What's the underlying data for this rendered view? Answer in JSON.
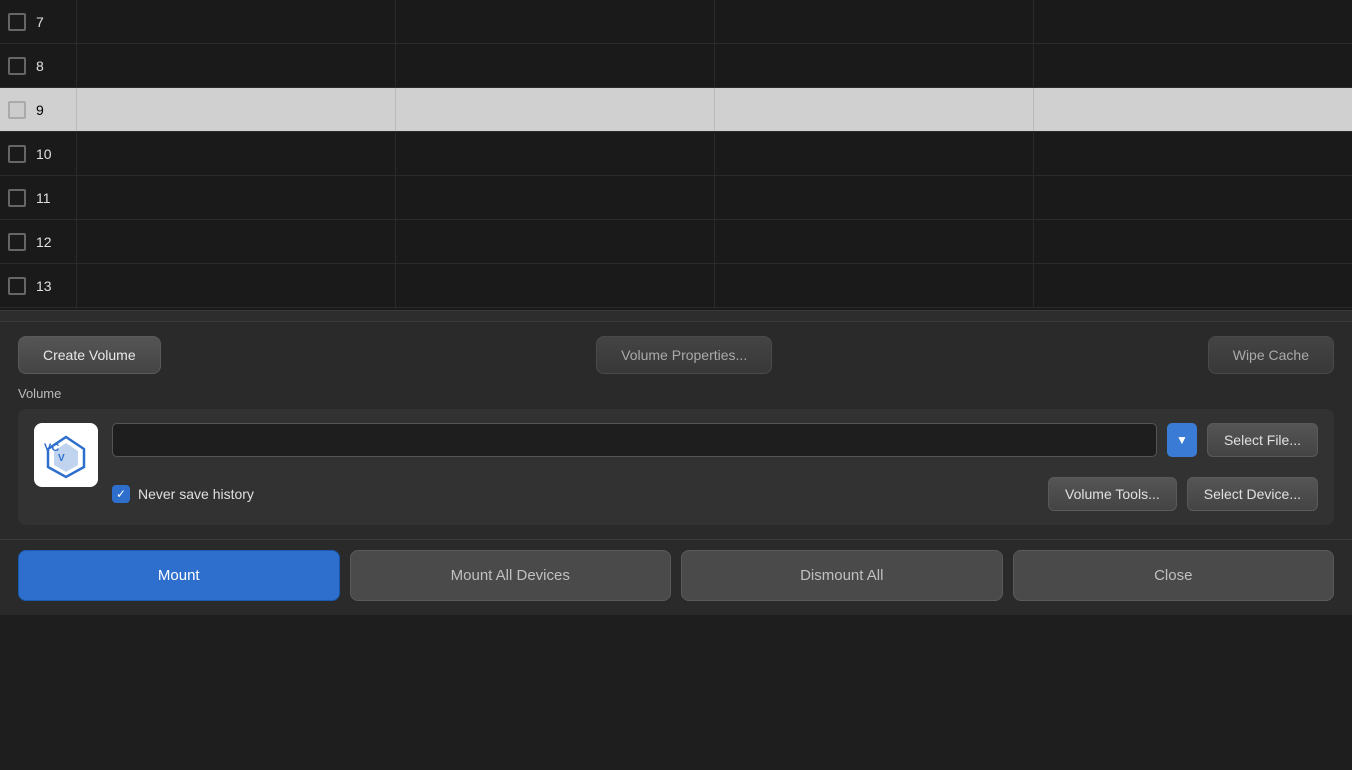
{
  "colors": {
    "background": "#1a1a1a",
    "controls_bg": "#2a2a2a",
    "volume_section_bg": "#323232",
    "selected_row_bg": "#d0d0d0",
    "blue": "#2e6fcd",
    "button_dark": "#4a4a4a",
    "text_primary": "#e0e0e0",
    "text_muted": "#aaa"
  },
  "table": {
    "rows": [
      {
        "number": "7",
        "selected": false
      },
      {
        "number": "8",
        "selected": false
      },
      {
        "number": "9",
        "selected": true
      },
      {
        "number": "10",
        "selected": false
      },
      {
        "number": "11",
        "selected": false
      },
      {
        "number": "12",
        "selected": false
      },
      {
        "number": "13",
        "selected": false
      }
    ]
  },
  "toolbar": {
    "create_volume_label": "Create Volume",
    "volume_properties_label": "Volume Properties...",
    "wipe_cache_label": "Wipe Cache"
  },
  "volume_section": {
    "section_label": "Volume",
    "input_value": "",
    "input_placeholder": "",
    "never_save_history_label": "Never save history",
    "never_save_history_checked": true,
    "select_file_label": "Select File...",
    "select_device_label": "Select Device...",
    "volume_tools_label": "Volume Tools..."
  },
  "bottom_buttons": {
    "mount_label": "Mount",
    "mount_all_devices_label": "Mount All Devices",
    "dismount_all_label": "Dismount All",
    "close_label": "Close"
  },
  "icons": {
    "checkbox_checked": "✓",
    "dropdown_arrow": "▼"
  }
}
